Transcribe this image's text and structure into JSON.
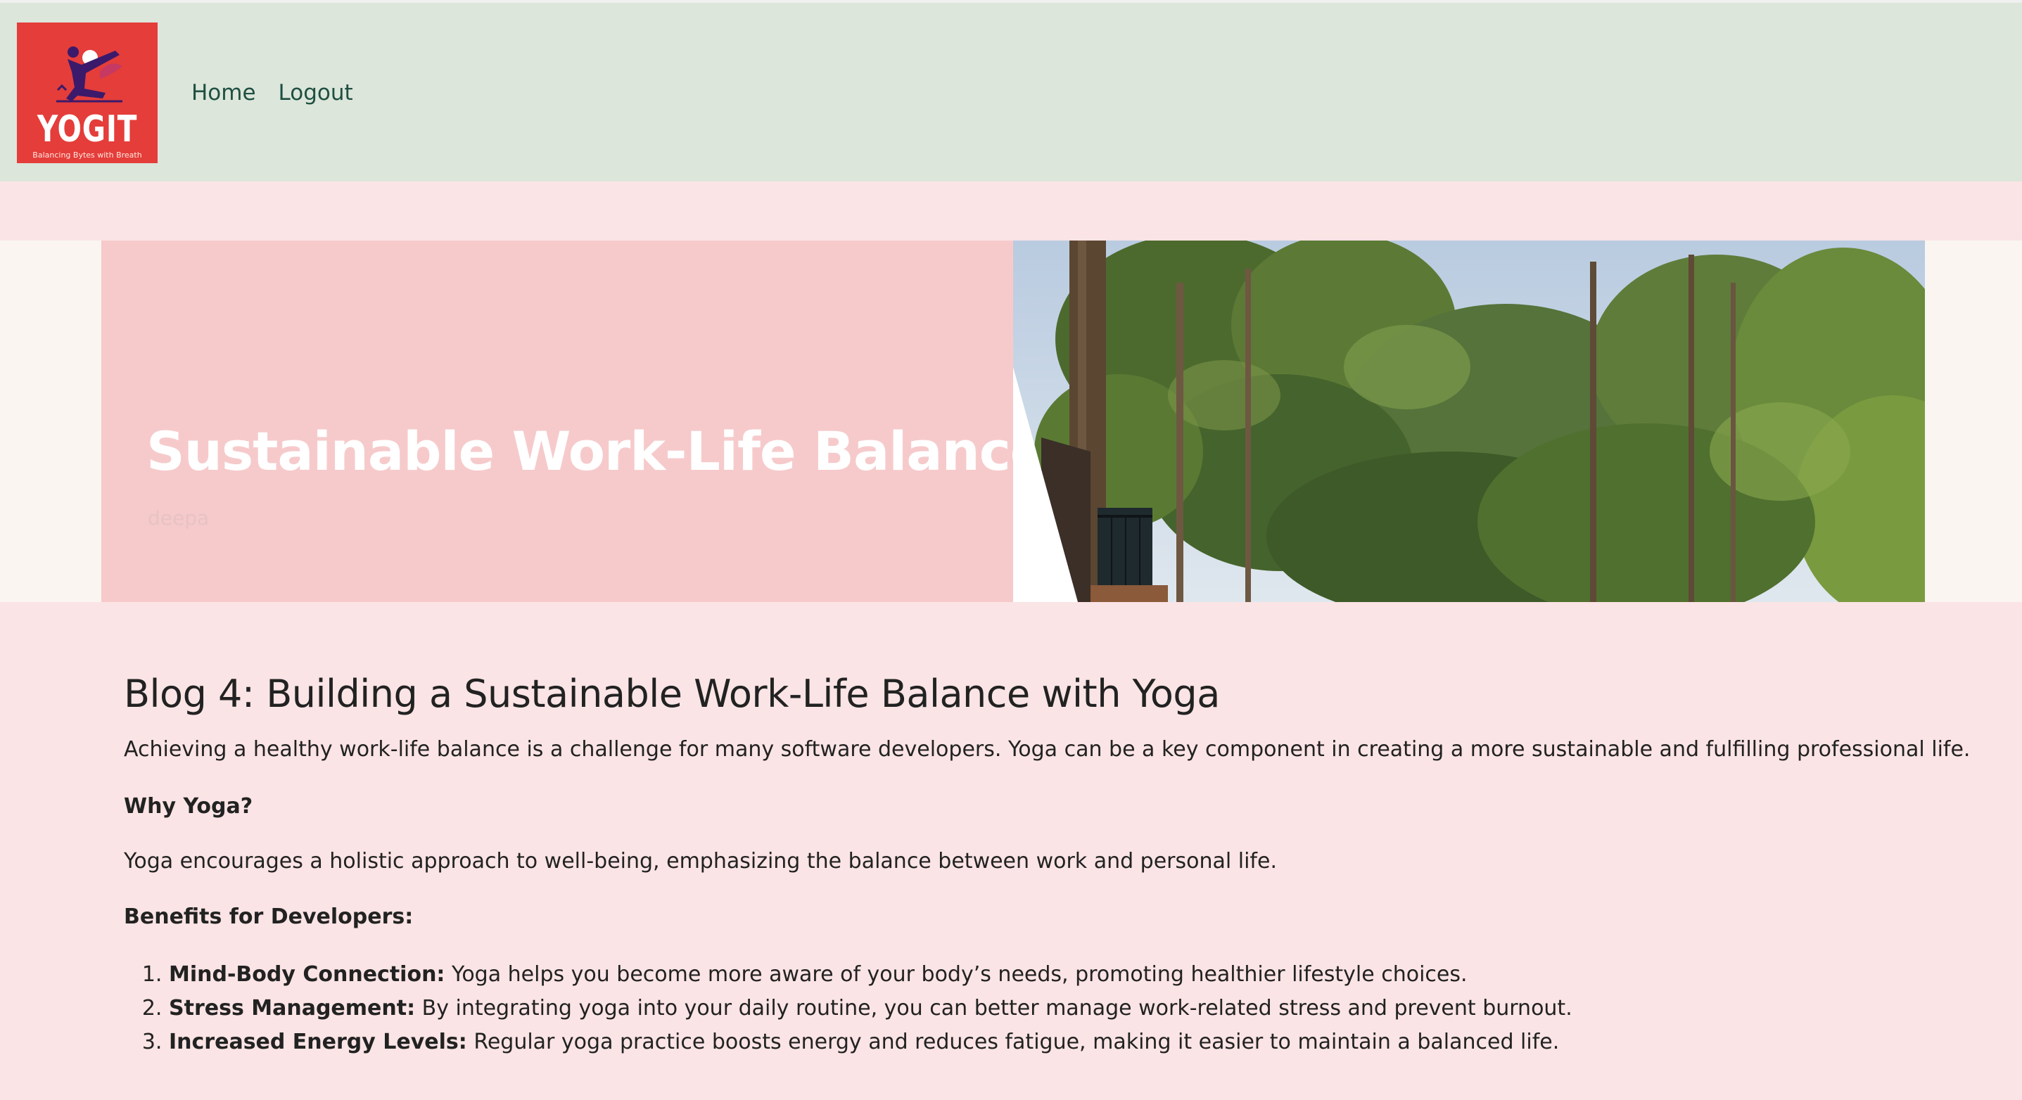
{
  "logo": {
    "word": "YOGIT",
    "tagline": "Balancing Bytes with Breath",
    "colors": {
      "background": "#e43d3a",
      "figure": "#3b1a6b"
    }
  },
  "nav": {
    "links": [
      {
        "label": "Home"
      },
      {
        "label": "Logout"
      }
    ]
  },
  "hero": {
    "title": "Sustainable Work-Life Balance",
    "author": "deepa",
    "image_icon": "forest-photo",
    "colors": {
      "panel": "#f6cacb",
      "band": "#faf5f0"
    }
  },
  "article": {
    "heading": "Blog 4: Building a Sustainable Work-Life Balance with Yoga",
    "intro": "Achieving a healthy work-life balance is a challenge for many software developers. Yoga can be a key component in creating a more sustainable and fulfilling professional life.",
    "why_heading": "Why Yoga?",
    "why_text": "Yoga encourages a holistic approach to well-being, emphasizing the balance between work and personal life.",
    "benefits_heading": "Benefits for Developers:",
    "benefits": [
      {
        "title": "Mind-Body Connection:",
        "text": " Yoga helps you become more aware of your body’s needs, promoting healthier lifestyle choices."
      },
      {
        "title": "Stress Management:",
        "text": " By integrating yoga into your daily routine, you can better manage work-related stress and prevent burnout."
      },
      {
        "title": "Increased Energy Levels:",
        "text": " Regular yoga practice boosts energy and reduces fatigue, making it easier to maintain a balanced life."
      }
    ]
  },
  "colors": {
    "page_bg": "#fbe4e5",
    "navbar_bg": "#dce6da",
    "nav_link": "#1f4f42"
  }
}
